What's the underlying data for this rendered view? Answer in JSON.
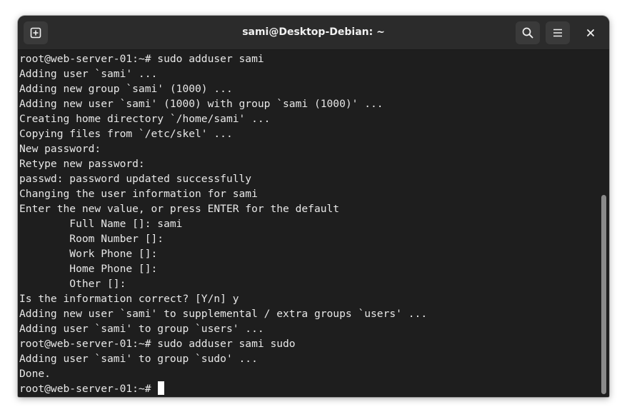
{
  "window": {
    "title": "sami@Desktop-Debian: ~"
  },
  "icons": {
    "new_tab": "new-tab-icon",
    "search": "search-icon",
    "menu": "hamburger-menu-icon",
    "close": "close-icon"
  },
  "colors": {
    "terminal_bg": "#1e1e1e",
    "headerbar_bg": "#2b2b2b",
    "text": "#e8e8e8"
  },
  "terminal": {
    "lines": [
      "root@web-server-01:~# sudo adduser sami",
      "Adding user `sami' ...",
      "Adding new group `sami' (1000) ...",
      "Adding new user `sami' (1000) with group `sami (1000)' ...",
      "Creating home directory `/home/sami' ...",
      "Copying files from `/etc/skel' ...",
      "New password:",
      "Retype new password:",
      "passwd: password updated successfully",
      "Changing the user information for sami",
      "Enter the new value, or press ENTER for the default",
      "        Full Name []: sami",
      "        Room Number []:",
      "        Work Phone []:",
      "        Home Phone []:",
      "        Other []:",
      "Is the information correct? [Y/n] y",
      "Adding new user `sami' to supplemental / extra groups `users' ...",
      "Adding user `sami' to group `users' ...",
      "root@web-server-01:~# sudo adduser sami sudo",
      "Adding user `sami' to group `sudo' ...",
      "Done."
    ],
    "prompt": "root@web-server-01:~# "
  }
}
